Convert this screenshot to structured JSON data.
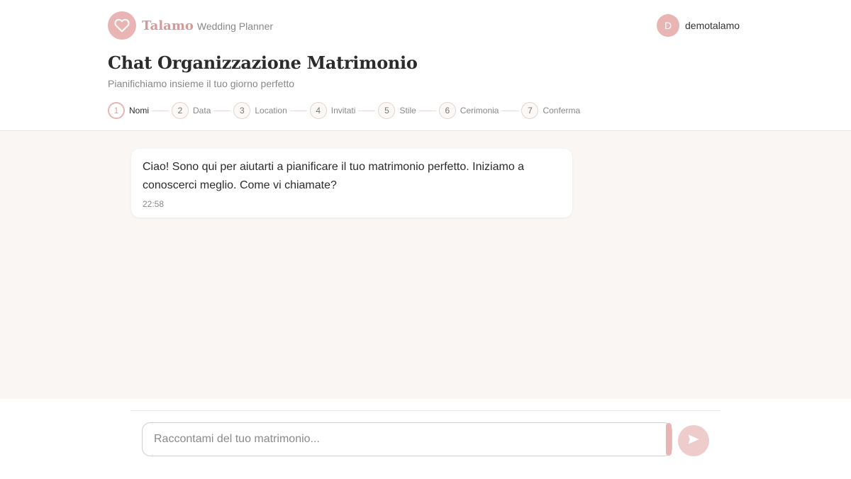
{
  "brand": {
    "name": "Talamo",
    "subtitle": "Wedding Planner",
    "logo_icon": "heart-icon",
    "color": "#e8b4b4"
  },
  "user": {
    "initial": "D",
    "name": "demotalamo"
  },
  "page": {
    "title": "Chat Organizzazione Matrimonio",
    "subtitle": "Pianifichiamo insieme il tuo giorno perfetto"
  },
  "steps": [
    {
      "number": "1",
      "label": "Nomi",
      "active": true
    },
    {
      "number": "2",
      "label": "Data",
      "active": false
    },
    {
      "number": "3",
      "label": "Location",
      "active": false
    },
    {
      "number": "4",
      "label": "Invitati",
      "active": false
    },
    {
      "number": "5",
      "label": "Stile",
      "active": false
    },
    {
      "number": "6",
      "label": "Cerimonia",
      "active": false
    },
    {
      "number": "7",
      "label": "Conferma",
      "active": false
    }
  ],
  "messages": [
    {
      "sender": "assistant",
      "text": "Ciao! Sono qui per aiutarti a pianificare il tuo matrimonio perfetto. Iniziamo a conoscerci meglio. Come vi chiamate?",
      "time": "22:58"
    }
  ],
  "composer": {
    "placeholder": "Raccontami del tuo matrimonio...",
    "value": "",
    "send_icon": "send-icon"
  },
  "colors": {
    "accent": "#e8b4b4",
    "chat_background": "#faf6f4"
  }
}
